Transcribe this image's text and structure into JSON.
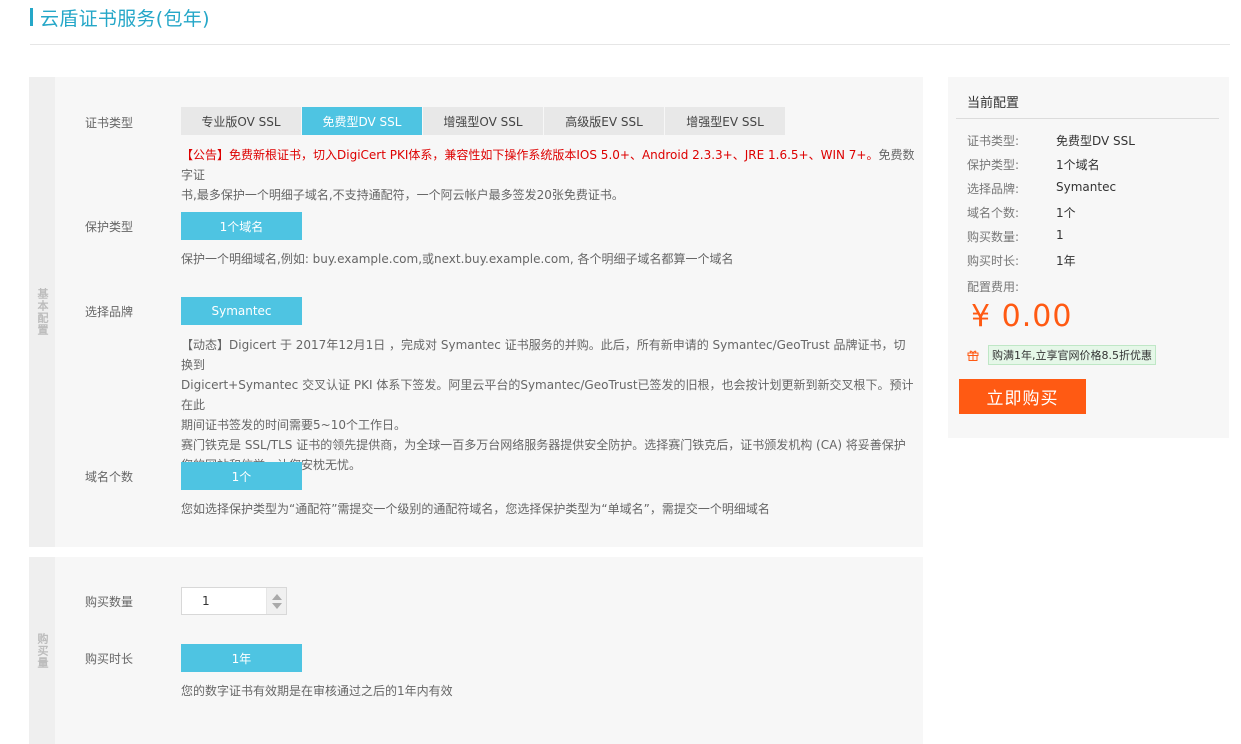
{
  "page": {
    "title": "云盾证书服务(包年)"
  },
  "basic": {
    "side_label": "基本配置",
    "cert_type": {
      "label": "证书类型",
      "options": [
        "专业版OV SSL",
        "免费型DV SSL",
        "增强型OV SSL",
        "高级版EV SSL",
        "增强型EV SSL"
      ],
      "selected": "免费型DV SSL",
      "notice": "【公告】免费新根证书，切入DigiCert PKI体系，兼容性如下操作系统版本IOS 5.0+、Android 2.3.3+、JRE 1.6.5+、WIN 7+。",
      "desc_line1": "免费数字证",
      "desc_line2": "书,最多保护一个明细子域名,不支持通配符，一个阿云帐户最多签发20张免费证书。"
    },
    "protect_type": {
      "label": "保护类型",
      "value": "1个域名",
      "desc": "保护一个明细域名,例如: buy.example.com,或next.buy.example.com, 各个明细子域名都算一个域名"
    },
    "brand": {
      "label": "选择品牌",
      "value": "Symantec",
      "desc_lines": [
        "【动态】Digicert 于 2017年12月1日 ，完成对 Symantec 证书服务的并购。此后，所有新申请的 Symantec/GeoTrust 品牌证书，切换到",
        "Digicert+Symantec 交叉认证 PKI 体系下签发。阿里云平台的Symantec/GeoTrust已签发的旧根，也会按计划更新到新交叉根下。预计在此",
        "期间证书签发的时间需要5~10个工作日。",
        "赛门铁克是 SSL/TLS 证书的领先提供商，为全球一百多万台网络服务器提供安全防护。选择赛门铁克后，证书颁发机构 (CA) 将妥善保护",
        "您的网站和信誉，让您安枕无忧。"
      ]
    },
    "domain_count": {
      "label": "域名个数",
      "value": "1个",
      "desc": "您如选择保护类型为“通配符”需提交一个级别的通配符域名，您选择保护类型为“单域名”，需提交一个明细域名"
    }
  },
  "purchase": {
    "side_label": "购买量",
    "quantity": {
      "label": "购买数量",
      "value": "1"
    },
    "duration": {
      "label": "购买时长",
      "value": "1年",
      "desc": "您的数字证书有效期是在审核通过之后的1年内有效"
    }
  },
  "summary": {
    "title": "当前配置",
    "rows": [
      {
        "k": "证书类型:",
        "v": "免费型DV SSL"
      },
      {
        "k": "保护类型:",
        "v": "1个域名"
      },
      {
        "k": "选择品牌:",
        "v": "Symantec"
      },
      {
        "k": "域名个数:",
        "v": "1个"
      },
      {
        "k": "购买数量:",
        "v": "1"
      },
      {
        "k": "购买时长:",
        "v": "1年"
      }
    ],
    "fee_label": "配置费用:",
    "price": "¥ 0.00",
    "promo": "购满1年,立享官网价格8.5折优惠",
    "buy_label": "立即购买"
  },
  "colors": {
    "accent": "#4ec4e2",
    "title": "#25a7c8",
    "price": "#ff5a13",
    "notice": "#dd0000"
  }
}
